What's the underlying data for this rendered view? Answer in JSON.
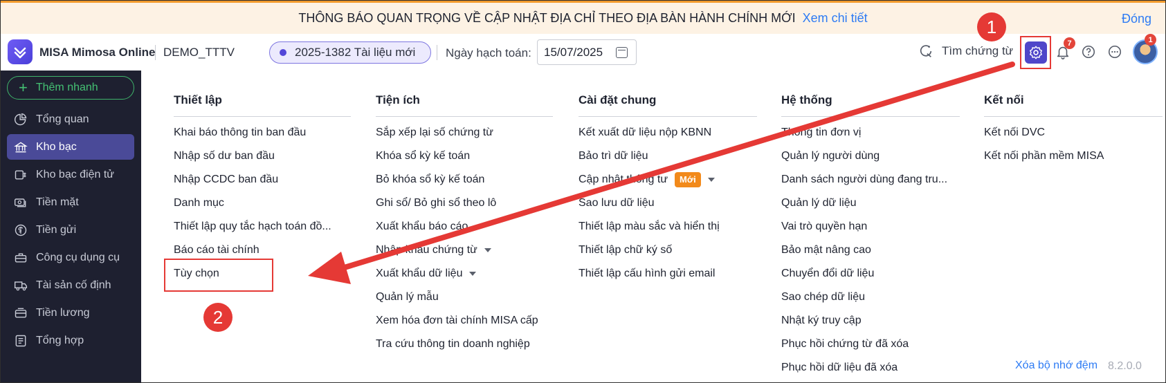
{
  "banner": {
    "message": "THÔNG BÁO QUAN TRỌNG VỀ CẬP NHẬT ĐỊA CHỈ THEO ĐỊA BÀN HÀNH CHÍNH MỚI",
    "link": "Xem chi tiết",
    "close": "Đóng",
    "accent_color": "#f29b2c",
    "link_color": "#2d7bf4"
  },
  "header": {
    "app_name": "MISA Mimosa Online",
    "database": "DEMO_TTTV",
    "document_pill": "2025-1382 Tài liệu mới",
    "date_label": "Ngày hạch toán:",
    "date_value": "15/07/2025",
    "search_documents": "Tìm chứng từ",
    "notification_count": "7",
    "avatar_badge": "1",
    "icons": [
      "calendar-icon",
      "search-doc-icon",
      "gear-icon",
      "bell-icon",
      "help-icon",
      "more-icon"
    ]
  },
  "sidebar": {
    "quick_add": "Thêm nhanh",
    "items": [
      {
        "label": "Tổng quan",
        "icon": "pie-chart-icon"
      },
      {
        "label": "Kho bạc",
        "icon": "bank-icon",
        "active": true
      },
      {
        "label": "Kho bạc điện tử",
        "icon": "money-transfer-icon"
      },
      {
        "label": "Tiền mặt",
        "icon": "cash-icon"
      },
      {
        "label": "Tiền gửi",
        "icon": "coin-icon"
      },
      {
        "label": "Công cụ dụng cụ",
        "icon": "tools-icon"
      },
      {
        "label": "Tài sản cố định",
        "icon": "truck-icon"
      },
      {
        "label": "Tiền lương",
        "icon": "salary-icon"
      },
      {
        "label": "Tổng hợp",
        "icon": "summary-icon"
      }
    ],
    "active_color": "#4a4a98"
  },
  "settings_menu": {
    "columns": [
      {
        "title": "Thiết lập",
        "items": [
          {
            "label": "Khai báo thông tin ban đầu"
          },
          {
            "label": "Nhập số dư ban đầu"
          },
          {
            "label": "Nhập CCDC ban đầu"
          },
          {
            "label": "Danh mục"
          },
          {
            "label": "Thiết lập quy tắc hạch toán đồ..."
          },
          {
            "label": "Báo cáo tài chính"
          },
          {
            "label": "Tùy chọn"
          }
        ]
      },
      {
        "title": "Tiện ích",
        "items": [
          {
            "label": "Sắp xếp lại số chứng từ"
          },
          {
            "label": "Khóa sổ kỳ kế toán"
          },
          {
            "label": "Bỏ khóa sổ kỳ kế toán"
          },
          {
            "label": "Ghi sổ/ Bỏ ghi sổ theo lô"
          },
          {
            "label": "Xuất khẩu báo cáo"
          },
          {
            "label": "Nhập khẩu chứng từ",
            "has_caret": true
          },
          {
            "label": "Xuất khẩu dữ liệu",
            "has_caret": true
          },
          {
            "label": "Quản lý mẫu"
          },
          {
            "label": "Xem hóa đơn tài chính MISA cấp"
          },
          {
            "label": "Tra cứu thông tin doanh nghiệp"
          }
        ]
      },
      {
        "title": "Cài đặt chung",
        "items": [
          {
            "label": "Kết xuất dữ liệu nộp KBNN"
          },
          {
            "label": "Bảo trì dữ liệu"
          },
          {
            "label": "Cập nhật thông tư",
            "tag": "Mới",
            "has_caret": true
          },
          {
            "label": "Sao lưu dữ liệu"
          },
          {
            "label": "Thiết lập màu sắc và hiển thị"
          },
          {
            "label": "Thiết lập chữ ký số"
          },
          {
            "label": "Thiết lập cấu hình gửi email"
          }
        ]
      },
      {
        "title": "Hệ thống",
        "items": [
          {
            "label": "Thông tin đơn vị"
          },
          {
            "label": "Quản lý người dùng"
          },
          {
            "label": "Danh sách người dùng đang tru..."
          },
          {
            "label": "Quản lý dữ liệu"
          },
          {
            "label": "Vai trò quyền hạn"
          },
          {
            "label": "Bảo mật nâng cao"
          },
          {
            "label": "Chuyển đổi dữ liệu"
          },
          {
            "label": "Sao chép dữ liệu"
          },
          {
            "label": "Nhật ký truy cập"
          },
          {
            "label": "Phục hồi chứng từ đã xóa"
          },
          {
            "label": "Phục hồi dữ liệu đã xóa"
          }
        ]
      },
      {
        "title": "Kết nối",
        "items": [
          {
            "label": "Kết nối DVC"
          },
          {
            "label": "Kết nối phần mềm MISA"
          }
        ]
      }
    ],
    "footer_link": "Xóa bộ nhớ đệm",
    "version": "8.2.0.0"
  },
  "annotations": {
    "step_1": "1",
    "step_2": "2",
    "highlight_color": "#e53935"
  }
}
